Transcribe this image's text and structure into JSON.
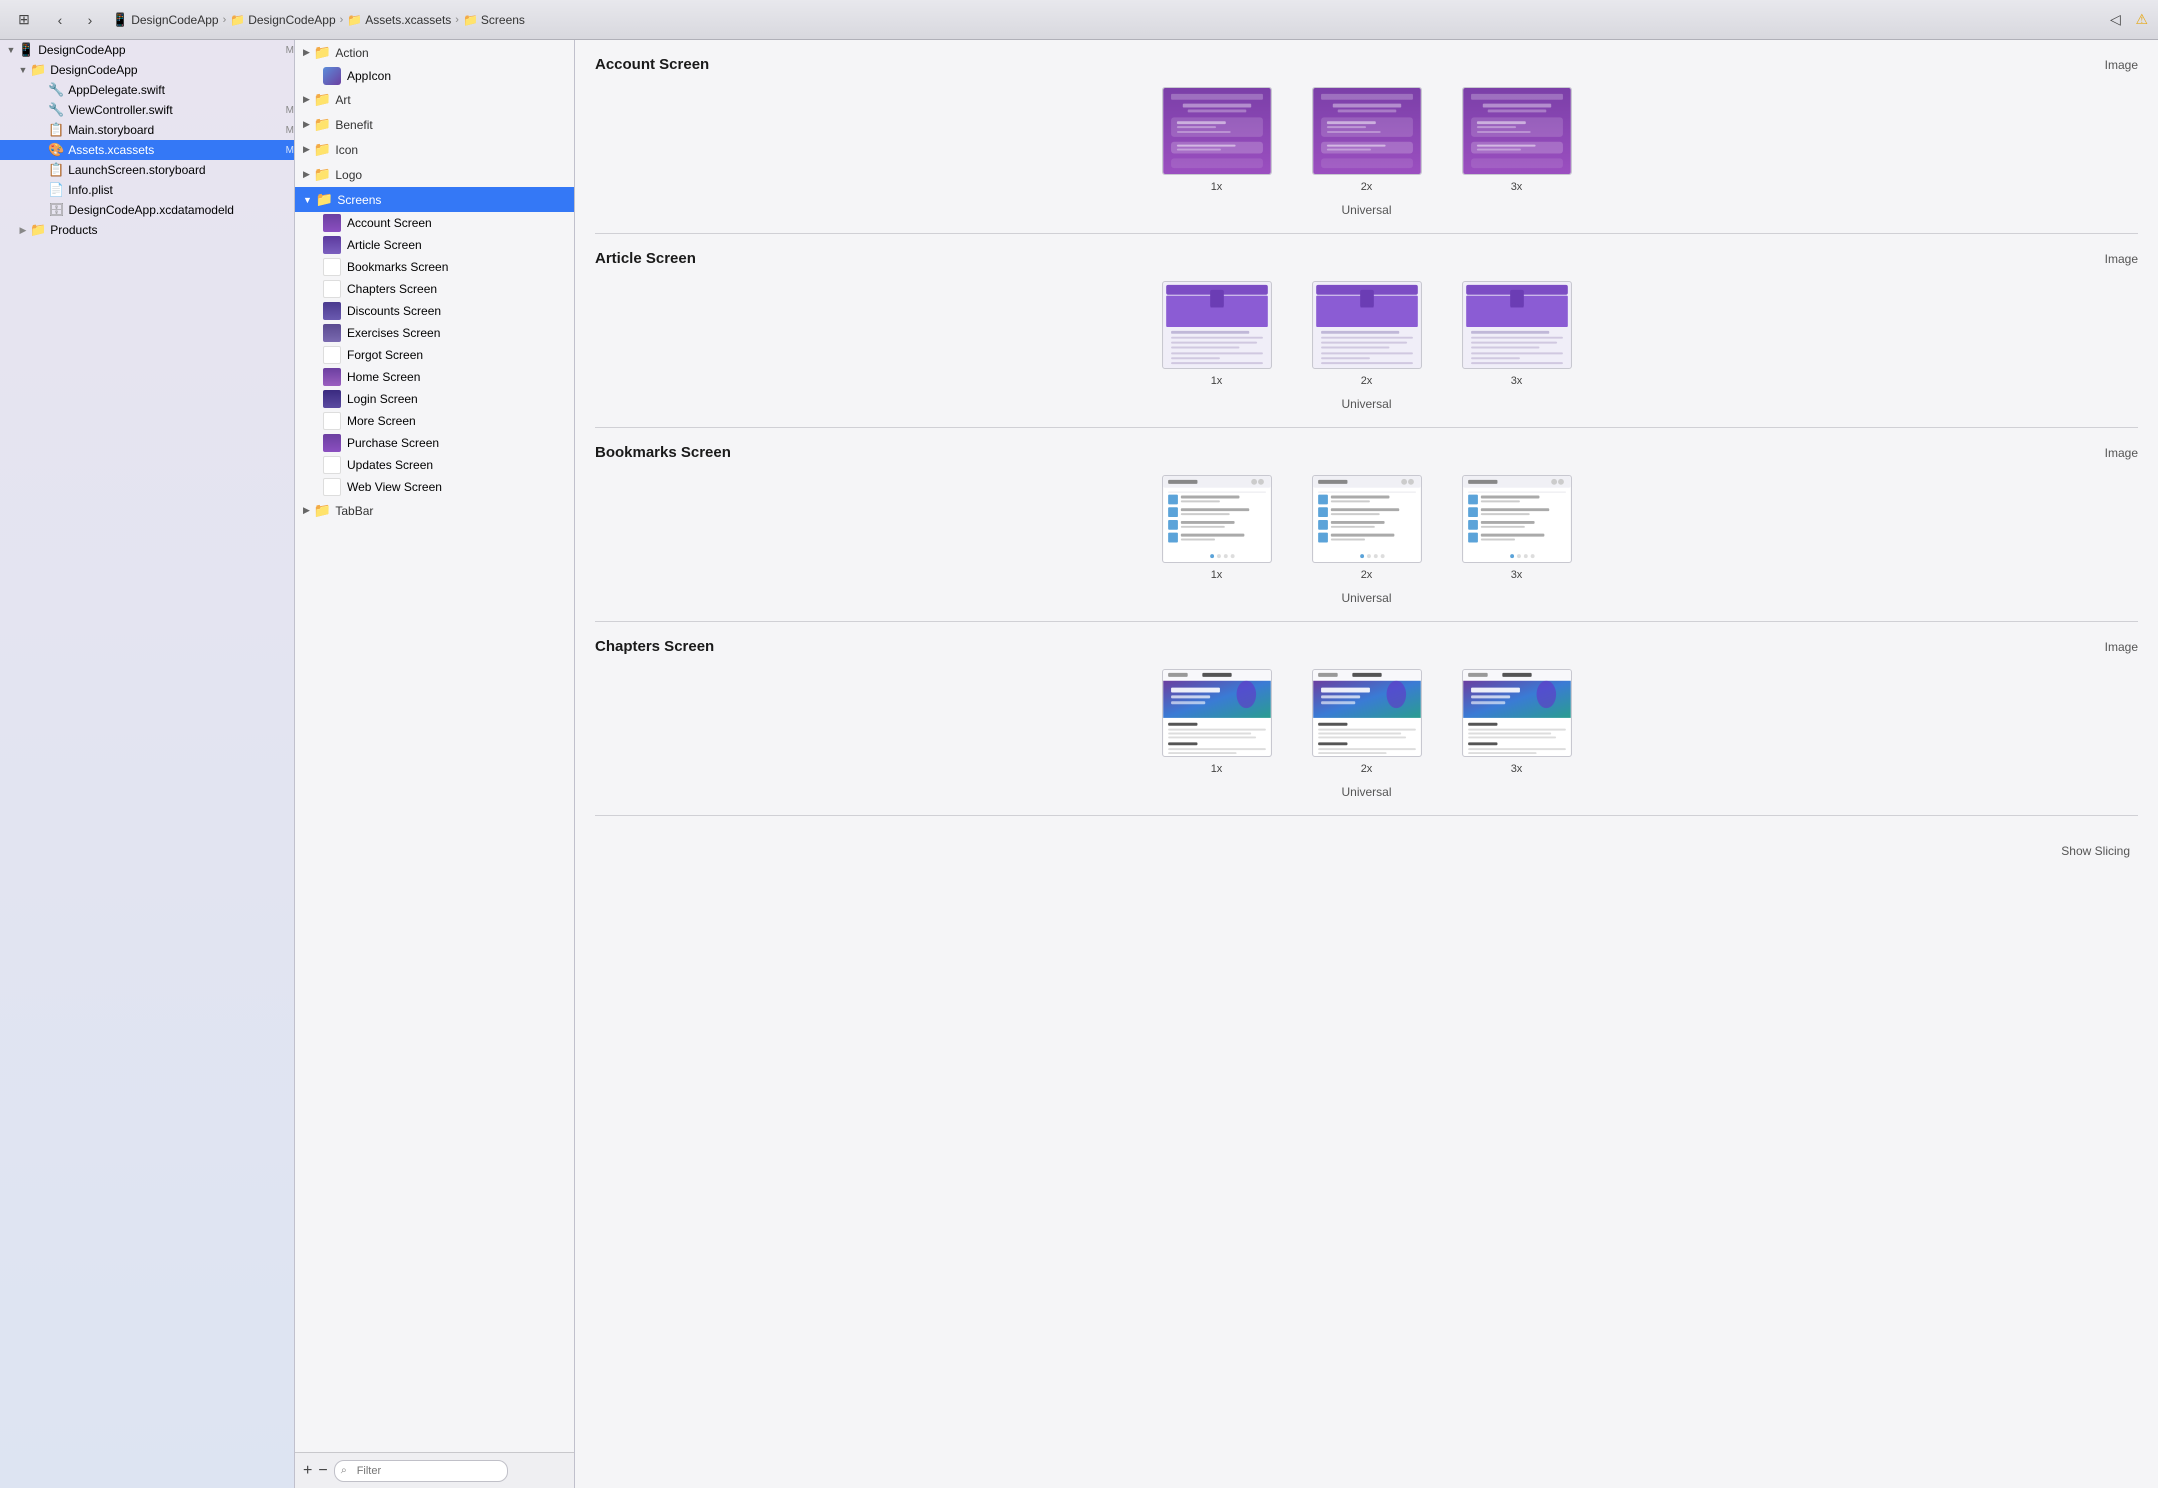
{
  "toolbar": {
    "back_label": "‹",
    "forward_label": "›",
    "breadcrumb": [
      {
        "label": "DesignCodeApp",
        "icon": "📱"
      },
      {
        "label": "DesignCodeApp",
        "icon": "📁"
      },
      {
        "label": "Assets.xcassets",
        "icon": "📁"
      },
      {
        "label": "Screens",
        "icon": "📁"
      }
    ],
    "left_icon": "⊞",
    "warning_icon": "⚠"
  },
  "file_tree": {
    "items": [
      {
        "id": "designcodeapp-root",
        "label": "DesignCodeApp",
        "level": 0,
        "expanded": true,
        "badge": "M",
        "type": "project",
        "icon": "📱"
      },
      {
        "id": "designcodeapp-folder",
        "label": "DesignCodeApp",
        "level": 1,
        "expanded": true,
        "badge": "",
        "type": "folder",
        "icon": "📁"
      },
      {
        "id": "appdelegate",
        "label": "AppDelegate.swift",
        "level": 2,
        "type": "swift",
        "icon": "🔧",
        "badge": ""
      },
      {
        "id": "viewcontroller",
        "label": "ViewController.swift",
        "level": 2,
        "type": "swift",
        "icon": "🔧",
        "badge": "M"
      },
      {
        "id": "mainstoryboard",
        "label": "Main.storyboard",
        "level": 2,
        "type": "storyboard",
        "icon": "📋",
        "badge": "M"
      },
      {
        "id": "assets",
        "label": "Assets.xcassets",
        "level": 2,
        "type": "assets",
        "icon": "🎨",
        "badge": "M",
        "selected": true
      },
      {
        "id": "launchscreen",
        "label": "LaunchScreen.storyboard",
        "level": 2,
        "type": "storyboard",
        "icon": "📋",
        "badge": ""
      },
      {
        "id": "infoplist",
        "label": "Info.plist",
        "level": 2,
        "type": "plist",
        "icon": "📄",
        "badge": ""
      },
      {
        "id": "datamodel",
        "label": "DesignCodeApp.xcdatamodeld",
        "level": 2,
        "type": "data",
        "icon": "🗄",
        "badge": ""
      },
      {
        "id": "products",
        "label": "Products",
        "level": 1,
        "expanded": false,
        "type": "folder",
        "icon": "📁",
        "badge": ""
      }
    ]
  },
  "asset_list": {
    "groups": [
      {
        "id": "action",
        "label": "Action",
        "expanded": true,
        "icon": "📁",
        "items": [
          {
            "label": "AppIcon",
            "icon": "app"
          }
        ]
      },
      {
        "id": "art",
        "label": "Art",
        "expanded": false,
        "icon": "📁",
        "items": []
      },
      {
        "id": "benefit",
        "label": "Benefit",
        "expanded": false,
        "icon": "📁",
        "items": []
      },
      {
        "id": "icon",
        "label": "Icon",
        "expanded": false,
        "icon": "📁",
        "items": []
      },
      {
        "id": "logo",
        "label": "Logo",
        "expanded": false,
        "icon": "📁",
        "items": []
      },
      {
        "id": "screens",
        "label": "Screens",
        "expanded": true,
        "icon": "📁",
        "selected": true,
        "items": [
          {
            "label": "Account Screen"
          },
          {
            "label": "Article Screen"
          },
          {
            "label": "Bookmarks Screen"
          },
          {
            "label": "Chapters Screen"
          },
          {
            "label": "Discounts Screen"
          },
          {
            "label": "Exercises Screen"
          },
          {
            "label": "Forgot Screen"
          },
          {
            "label": "Home Screen"
          },
          {
            "label": "Login Screen"
          },
          {
            "label": "More Screen"
          },
          {
            "label": "Purchase Screen"
          },
          {
            "label": "Updates Screen"
          },
          {
            "label": "Web View Screen"
          }
        ]
      },
      {
        "id": "tabbar",
        "label": "TabBar",
        "expanded": false,
        "icon": "📁",
        "items": []
      }
    ],
    "footer": {
      "add_label": "+",
      "remove_label": "−",
      "filter_placeholder": "Filter"
    }
  },
  "asset_detail": {
    "sections": [
      {
        "id": "account-screen",
        "title": "Account Screen",
        "type_label": "Image",
        "slots": [
          {
            "scale": "1x"
          },
          {
            "scale": "2x"
          },
          {
            "scale": "3x"
          }
        ],
        "universal_label": "Universal"
      },
      {
        "id": "article-screen",
        "title": "Article Screen",
        "type_label": "Image",
        "slots": [
          {
            "scale": "1x"
          },
          {
            "scale": "2x"
          },
          {
            "scale": "3x"
          }
        ],
        "universal_label": "Universal"
      },
      {
        "id": "bookmarks-screen",
        "title": "Bookmarks Screen",
        "type_label": "Image",
        "slots": [
          {
            "scale": "1x"
          },
          {
            "scale": "2x"
          },
          {
            "scale": "3x"
          }
        ],
        "universal_label": "Universal"
      },
      {
        "id": "chapters-screen",
        "title": "Chapters Screen",
        "type_label": "Image",
        "slots": [
          {
            "scale": "1x"
          },
          {
            "scale": "2x"
          },
          {
            "scale": "3x"
          }
        ],
        "universal_label": "Universal"
      }
    ],
    "show_slicing_label": "Show Slicing"
  }
}
